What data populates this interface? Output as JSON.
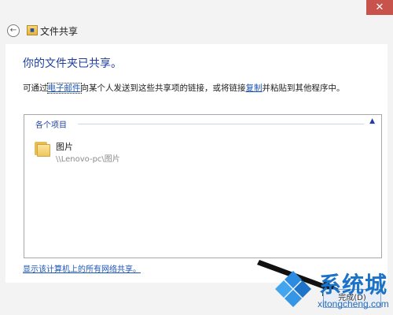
{
  "window": {
    "close_glyph": "✕",
    "title": "文件共享",
    "icon": "network-share-wizard-icon"
  },
  "content": {
    "heading": "你的文件夹已共享。",
    "description": {
      "part1": "可通过",
      "email_link": "电子邮件",
      "part2": "向某个人发送到这些共享项的链接，或将链接",
      "copy_link": "复制",
      "part3": "并粘贴到其他程序中。"
    },
    "files": {
      "group_header": "各个项目",
      "items": [
        {
          "name": "图片",
          "path": "\\\\Lenovo-pc\\图片",
          "icon": "folder-icon"
        }
      ]
    },
    "bottom_link": "显示该计算机上的所有网络共享。"
  },
  "footer": {
    "finish_label": "完成(D)"
  },
  "watermark": {
    "text_cn": "系统城",
    "text_en": "xitongcheng.com"
  },
  "colors": {
    "heading": "#1f3fa0",
    "link": "#1a55b8",
    "close": "#c7534c",
    "watermark": "#1a73c8"
  }
}
